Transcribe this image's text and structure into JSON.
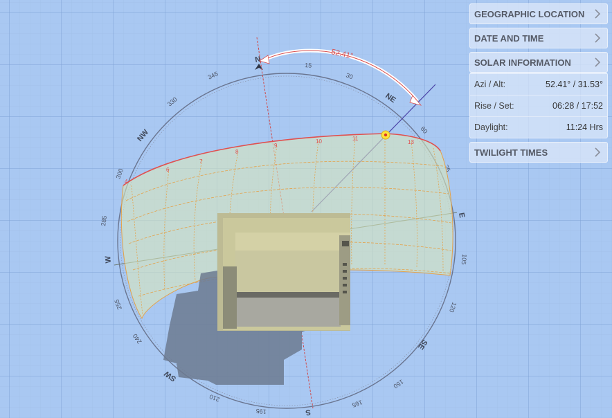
{
  "scene": {
    "compass_ticks": [
      "345",
      "330",
      "315",
      "300",
      "285",
      "270",
      "255",
      "240",
      "225",
      "210",
      "195",
      "180",
      "165",
      "150",
      "135",
      "120",
      "105",
      "90",
      "75",
      "60",
      "45",
      "30",
      "15",
      "0"
    ],
    "compass_points": [
      "N",
      "NE",
      "E",
      "SE",
      "S",
      "SW",
      "W",
      "NW"
    ],
    "azimuth_label": "52.41°",
    "hour_labels": [
      "4",
      "5",
      "6",
      "7",
      "8",
      "9",
      "10",
      "11",
      "12",
      "13",
      "14",
      "15",
      "16",
      "17",
      "18",
      "19",
      "20"
    ]
  },
  "panel": {
    "geo": {
      "label": "GEOGRAPHIC LOCATION"
    },
    "date": {
      "label": "DATE AND TIME"
    },
    "solar": {
      "label": "SOLAR INFORMATION",
      "azi_alt": {
        "label": "Azi / Alt:",
        "value": "52.41° / 31.53°"
      },
      "rise_set": {
        "label": "Rise / Set:",
        "value": "06:28 / 17:52"
      },
      "daylight": {
        "label": "Daylight:",
        "value": "11:24 Hrs"
      }
    },
    "twilight": {
      "label": "TWILIGHT TIMES"
    }
  },
  "colors": {
    "background": "#a9c8f2",
    "sunpath": "#e05050",
    "dome": "#d8e6bd"
  }
}
